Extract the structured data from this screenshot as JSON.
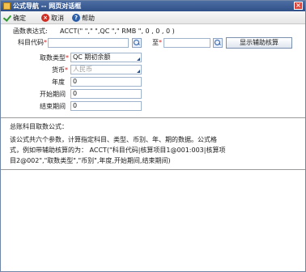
{
  "window": {
    "title": "公式导航 -- 网页对话框",
    "close_glyph": "×"
  },
  "toolbar": {
    "confirm_label": "确定",
    "cancel_label": "取消",
    "help_label": "帮助"
  },
  "expression": {
    "label": "函数表达式:",
    "value": "ACCT(\" \",\" \",QC \",\" RMB \", 0 , 0 , 0 )"
  },
  "account": {
    "label": "科目代码",
    "to_label": "至",
    "aux_button": "显示辅助核算"
  },
  "fetch_type": {
    "label": "取数类型",
    "value": "QC 期初余额"
  },
  "currency": {
    "label": "货币",
    "value": "人民币"
  },
  "year": {
    "label": "年度",
    "value": "0"
  },
  "start_period": {
    "label": "开始期间",
    "value": "0"
  },
  "end_period": {
    "label": "结束期间",
    "value": "0"
  },
  "description": {
    "heading": "总账科目取数公式：",
    "line1": "该公式共六个参数，计算指定科目、类型、币别、年、期的数据。公式格",
    "line2": "式，例如带辅助核算的为： ACCT(\"科目代码|核算项目1@001:003|核算项",
    "line3": "目2@002\",\"取数类型\",\"币别\",年度,开始期间,结束期间)"
  },
  "colors": {
    "titlebar": "#3a5b92",
    "required": "#d42020",
    "field_border": "#9fb3cc"
  }
}
